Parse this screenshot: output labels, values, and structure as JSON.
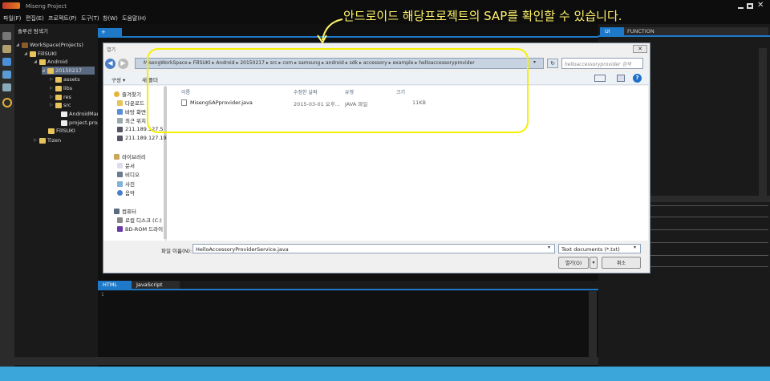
{
  "app": {
    "title": "Miseng Project",
    "logo": "app-logo-icon"
  },
  "callout": {
    "text": "안드로이드 해당프로젝트의 SAP를 확인할 수 있습니다."
  },
  "menu": [
    "파일(F)",
    "편집(E)",
    "프로젝트(P)",
    "도구(T)",
    "창(W)",
    "도움말(H)"
  ],
  "window_controls": [
    "minimize-icon",
    "maximize-icon",
    "close-icon"
  ],
  "explorer": {
    "title": "솔루션 탐색기",
    "items": [
      {
        "label": "WorkSpace(Projects)",
        "level": 0
      },
      {
        "label": "FillSUKI",
        "level": 1
      },
      {
        "label": "Android",
        "level": 2
      },
      {
        "label": "20150217",
        "level": 3
      },
      {
        "label": "assets",
        "level": 4
      },
      {
        "label": "libs",
        "level": 4
      },
      {
        "label": "res",
        "level": 4
      },
      {
        "label": "src",
        "level": 4
      },
      {
        "label": "AndroidMar",
        "level": 5
      },
      {
        "label": "project.prop",
        "level": 5
      },
      {
        "label": "FillSUKI",
        "level": 3
      },
      {
        "label": "Tizen",
        "level": 2
      }
    ]
  },
  "editor": {
    "tab_plus": "+"
  },
  "dialog": {
    "title": "열기",
    "breadcrumb": [
      "MisengWorkSpace",
      "FillSUKI",
      "Android",
      "20150217",
      "src",
      "com",
      "samsung",
      "android",
      "sdk",
      "accessory",
      "example",
      "helloaccessoryprovider"
    ],
    "search_placeholder": "helloaccessoryprovider 검색",
    "toolbar": {
      "organize": "구성 ▾",
      "new_folder": "새 폴더"
    },
    "nav": [
      {
        "label": "즐겨찾기",
        "icon": "star-icon"
      },
      {
        "label": "다운로드",
        "icon": "download-folder-icon"
      },
      {
        "label": "바탕 화면",
        "icon": "desktop-icon"
      },
      {
        "label": "최근 위치",
        "icon": "recent-places-icon"
      },
      {
        "label": "211.189.127.5",
        "icon": "network-drive-icon"
      },
      {
        "label": "211.189.127.19",
        "icon": "network-drive-icon"
      },
      {
        "label": "라이브러리",
        "icon": "library-icon"
      },
      {
        "label": "문서",
        "icon": "documents-icon"
      },
      {
        "label": "비디오",
        "icon": "video-icon"
      },
      {
        "label": "사진",
        "icon": "pictures-icon"
      },
      {
        "label": "음악",
        "icon": "music-icon"
      },
      {
        "label": "컴퓨터",
        "icon": "computer-icon"
      },
      {
        "label": "로컬 디스크 (C:)",
        "icon": "disk-icon"
      },
      {
        "label": "BD-ROM 드라이",
        "icon": "bd-rom-icon"
      }
    ],
    "columns": [
      "이름",
      "수정한 날짜",
      "유형",
      "크기"
    ],
    "files": [
      {
        "name": "MisengSAPprovider.java",
        "date": "2015-03-01 오후...",
        "type": "JAVA 파일",
        "size": "11KB"
      }
    ],
    "filename_label": "파일 이름(N):",
    "filename_value": "HelloAccessoryProviderService.java",
    "filter": "Text documents (*.txt)",
    "open_button": "열기(O)",
    "cancel_button": "취소"
  },
  "lower_tabs": [
    "HTML",
    "JavaScript"
  ],
  "lower_line": "1",
  "right_panel": {
    "tab1": "UI",
    "tab2": "FUNCTION"
  },
  "colors": {
    "accent": "#1e79c8",
    "status": "#3aa6d9",
    "annotation": "#f5f000"
  }
}
